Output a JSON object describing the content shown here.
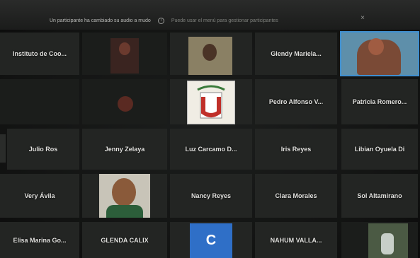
{
  "meeting": {
    "notice_text": "Un participante ha cambiado su audio a mudo",
    "notice_muted": "Puede usar el menú para gestionar participantes",
    "close_glyph": "×"
  },
  "participants": [
    {
      "name": "Instituto de Coo..."
    },
    {
      "name": ""
    },
    {
      "name": ""
    },
    {
      "name": "Glendy Mariela..."
    },
    {
      "name": ""
    },
    {
      "name": ""
    },
    {
      "name": ""
    },
    {
      "name": ""
    },
    {
      "name": "Pedro Alfonso V..."
    },
    {
      "name": "Patricia Romero..."
    },
    {
      "name": "Julio Ros"
    },
    {
      "name": "Jenny Zelaya"
    },
    {
      "name": "Luz Carcamo D..."
    },
    {
      "name": "Iris Reyes"
    },
    {
      "name": "Libian Oyuela Di"
    },
    {
      "name": "Very Ávila"
    },
    {
      "name": ""
    },
    {
      "name": "Nancy Reyes"
    },
    {
      "name": "Clara Morales"
    },
    {
      "name": "Sol Altamirano"
    },
    {
      "name": "Elisa Marina Go..."
    },
    {
      "name": "GLENDA CALIX"
    },
    {
      "name": ""
    },
    {
      "name": "NAHUM VALLA..."
    },
    {
      "name": ""
    }
  ],
  "avatar_initial": "C",
  "colors": {
    "active_speaker": "#3f8fd0",
    "avatar_bg": "#2f6fc7"
  }
}
